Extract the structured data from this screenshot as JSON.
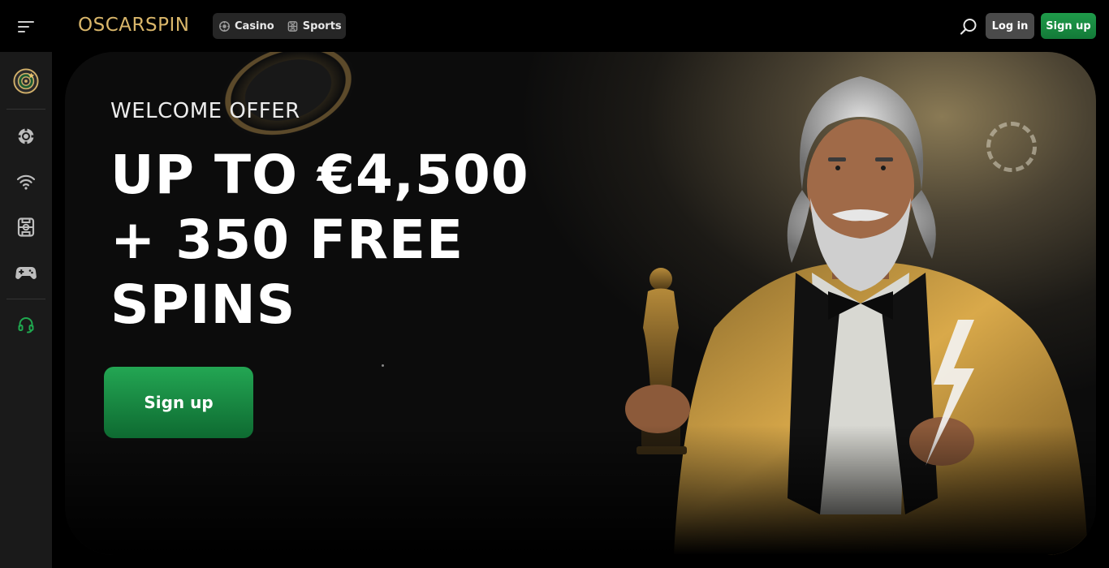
{
  "header": {
    "logo_text": "OSCARSPIN",
    "nav": [
      {
        "label": "Casino",
        "icon": "casino-chip-icon"
      },
      {
        "label": "Sports",
        "icon": "sports-icon"
      }
    ],
    "login_label": "Log in",
    "signup_label": "Sign up"
  },
  "sidebar": {
    "items": [
      {
        "name": "bonus",
        "icon": "target-badge-icon"
      },
      {
        "name": "casino",
        "icon": "casino-chip-icon"
      },
      {
        "name": "live",
        "icon": "wifi-icon"
      },
      {
        "name": "sports",
        "icon": "sports-icon"
      },
      {
        "name": "games",
        "icon": "gamepad-icon"
      },
      {
        "name": "support",
        "icon": "headset-icon"
      }
    ]
  },
  "hero": {
    "eyebrow": "WELCOME OFFER",
    "headline_line1": "UP TO €4,500",
    "headline_line2": "+ 350 FREE",
    "headline_line3": "SPINS",
    "cta_label": "Sign up"
  },
  "colors": {
    "accent_green": "#1a8c43",
    "logo_gold": "#d9b66a",
    "background": "#000000"
  }
}
